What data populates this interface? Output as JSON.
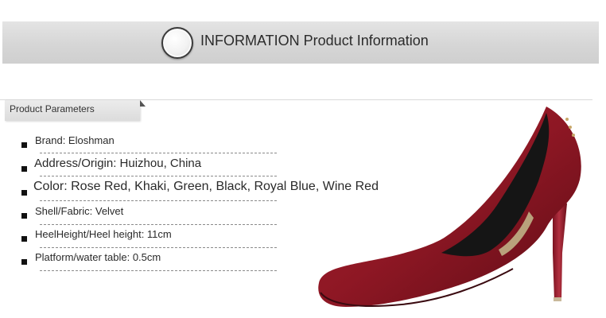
{
  "banner": {
    "title": "INFORMATION Product Information"
  },
  "section": {
    "tab_label": "Product Parameters"
  },
  "specs": [
    {
      "text": "Brand: Eloshman"
    },
    {
      "text": "Address/Origin: Huizhou, China"
    },
    {
      "text": "Color: Rose Red, Khaki, Green, Black, Royal Blue, Wine Red"
    },
    {
      "text": "Shell/Fabric: Velvet"
    },
    {
      "text": "HeelHeight/Heel height: 11cm"
    },
    {
      "text": "Platform/water table: 0.5cm"
    }
  ],
  "colors": {
    "banner": "#d6d6d6",
    "shoe_suede": "#8e1724",
    "shoe_lining": "#1a1a1a"
  },
  "image": {
    "subject": "wine red velvet pointed-toe high heel pump",
    "icon": "shoe-image"
  }
}
